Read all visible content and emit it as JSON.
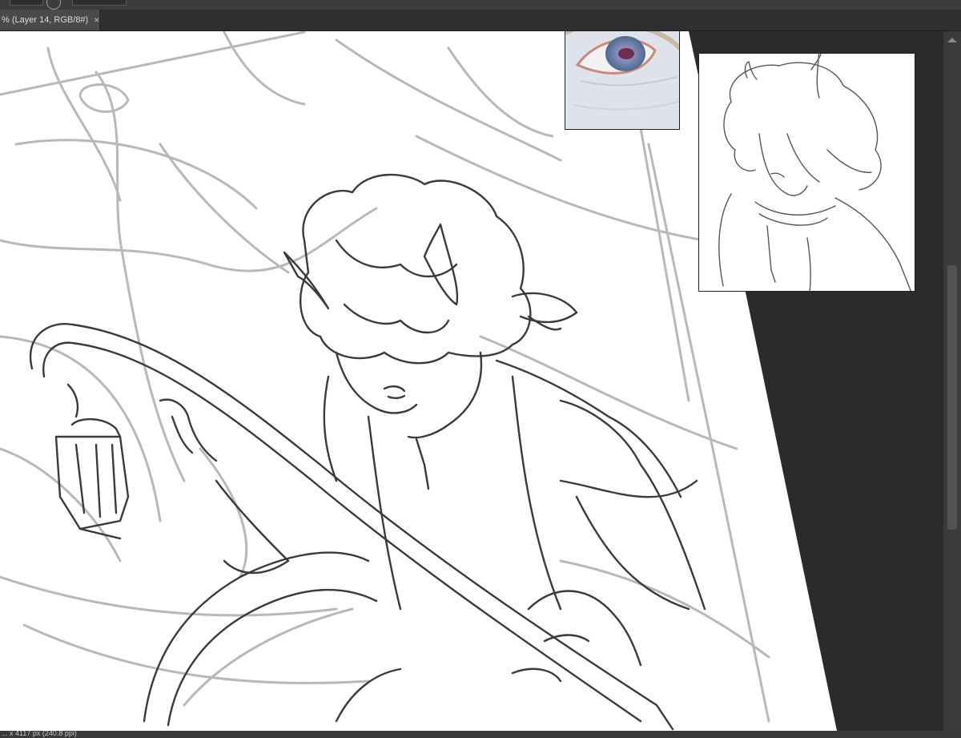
{
  "window": {
    "document_tab_title": "% (Layer 14, RGB/8#)",
    "close_glyph": "×"
  },
  "status_bar": {
    "document_info": "... x 4117 px (240.8 ppi)"
  },
  "reference_images": [
    {
      "name": "eye-reference-photo"
    },
    {
      "name": "character-sketch-reference"
    }
  ],
  "colors": {
    "canvas_bg": "#2b2b2b",
    "paper": "#ffffff",
    "ui_dark": "#2f2f2f",
    "sketch_line": "#3a3a3a",
    "sketch_light": "#b5b5b5"
  }
}
